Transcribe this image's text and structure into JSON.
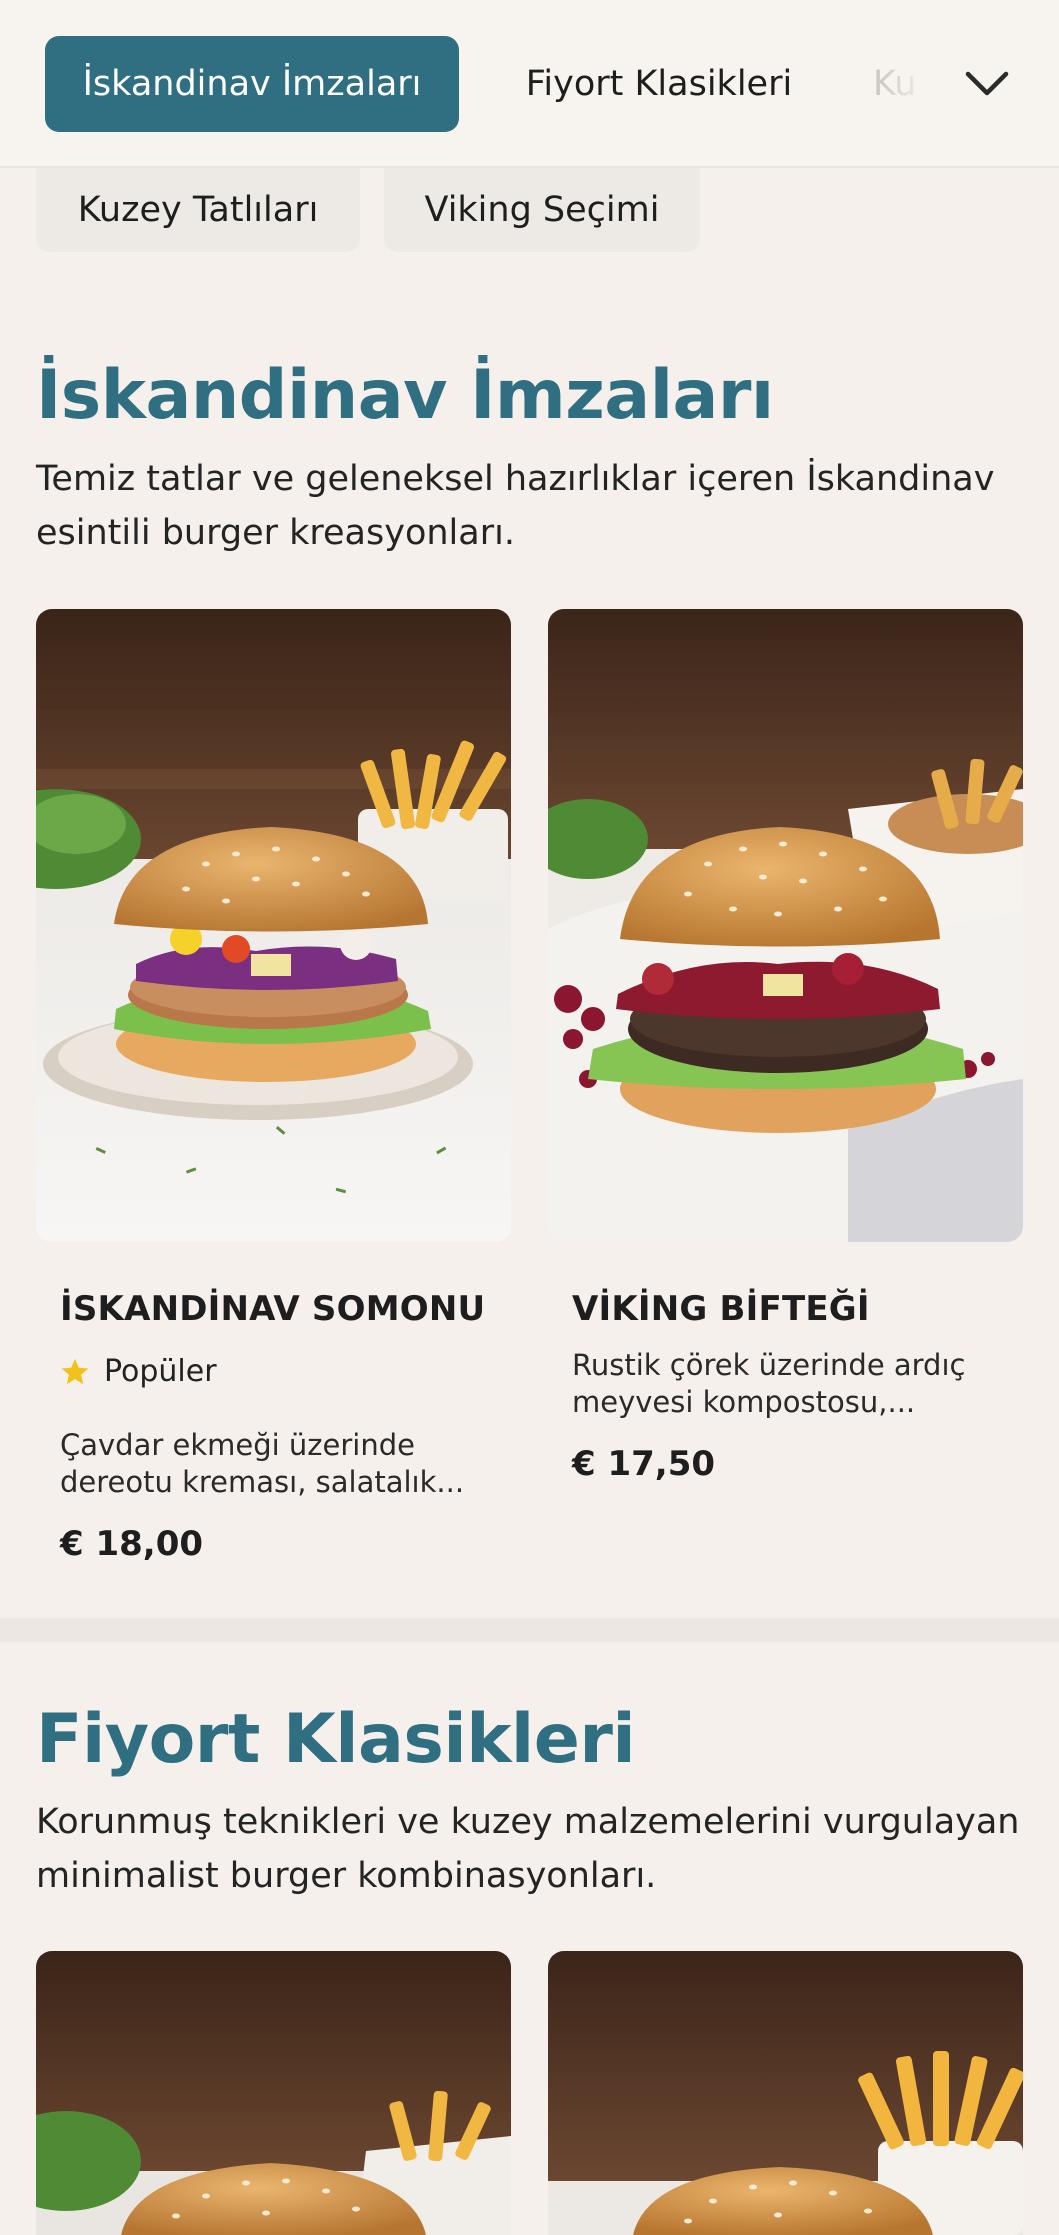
{
  "category_nav": {
    "tabs": [
      {
        "label": "İskandinav İmzaları",
        "active": true
      },
      {
        "label": "Fiyort Klasikleri",
        "active": false
      },
      {
        "label": "Ku",
        "active": false
      }
    ],
    "more_icon": "chevron-down-icon",
    "second_row": [
      {
        "label": "Kuzey Tatlıları"
      },
      {
        "label": "Viking Seçimi"
      }
    ]
  },
  "sections": [
    {
      "title": "İskandinav İmzaları",
      "description": "Temiz tatlar ve geleneksel hazırlıklar içeren İskandinav esintili burger kreasyonları.",
      "items": [
        {
          "name": "İSKANDİNAV SOMONU",
          "badge": "Popüler",
          "badge_icon": "star-icon",
          "description": "Çavdar ekmeği üzerinde dereotu kreması, salatalık...",
          "price": "€ 18,00"
        },
        {
          "name": "VİKİNG BİFTEĞİ",
          "description": "Rustik çörek üzerinde ardıç meyvesi kompostosu,...",
          "price": "€ 17,50"
        }
      ]
    },
    {
      "title": "Fiyort Klasikleri",
      "description": "Korunmuş teknikleri ve kuzey malzemelerini vurgulayan minimalist burger kombinasyonları."
    }
  ],
  "colors": {
    "accent": "#2f6f81",
    "background": "#f5f0ec",
    "star": "#f2c21b"
  }
}
